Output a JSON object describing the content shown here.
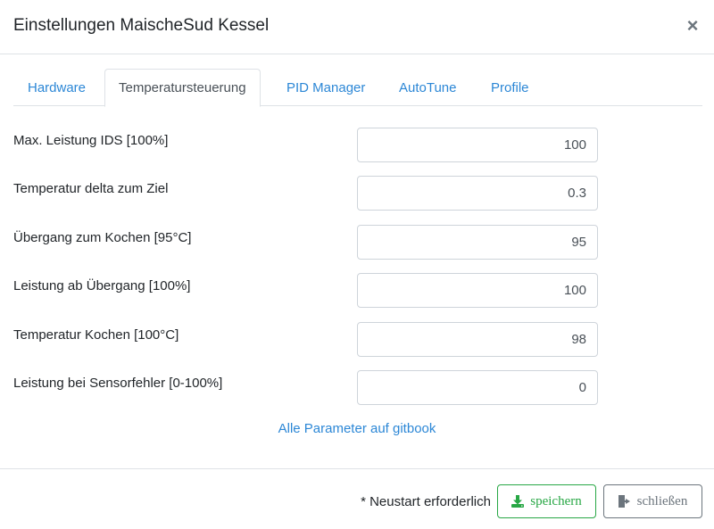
{
  "header": {
    "title": "Einstellungen MaischeSud Kessel",
    "close_label": "×"
  },
  "tabs": [
    {
      "label": "Hardware",
      "active": false
    },
    {
      "label": "Temperatursteuerung",
      "active": true
    },
    {
      "label": "PID Manager",
      "active": false
    },
    {
      "label": "AutoTune",
      "active": false
    },
    {
      "label": "Profile",
      "active": false
    }
  ],
  "fields": [
    {
      "label": "Max. Leistung IDS [100%]",
      "value": "100"
    },
    {
      "label": "Temperatur delta zum Ziel",
      "value": "0.3"
    },
    {
      "label": "Übergang zum Kochen [95°C]",
      "value": "95"
    },
    {
      "label": "Leistung ab Übergang [100%]",
      "value": "100"
    },
    {
      "label": "Temperatur Kochen [100°C]",
      "value": "98"
    },
    {
      "label": "Leistung bei Sensorfehler [0-100%]",
      "value": "0"
    }
  ],
  "doc_link": "Alle Parameter auf gitbook",
  "footer": {
    "restart_note": "* Neustart erforderlich",
    "save_label": "speichern",
    "close_label": "schließen"
  },
  "colors": {
    "link": "#2c87d6",
    "save": "#28a745",
    "close": "#6c757d"
  }
}
